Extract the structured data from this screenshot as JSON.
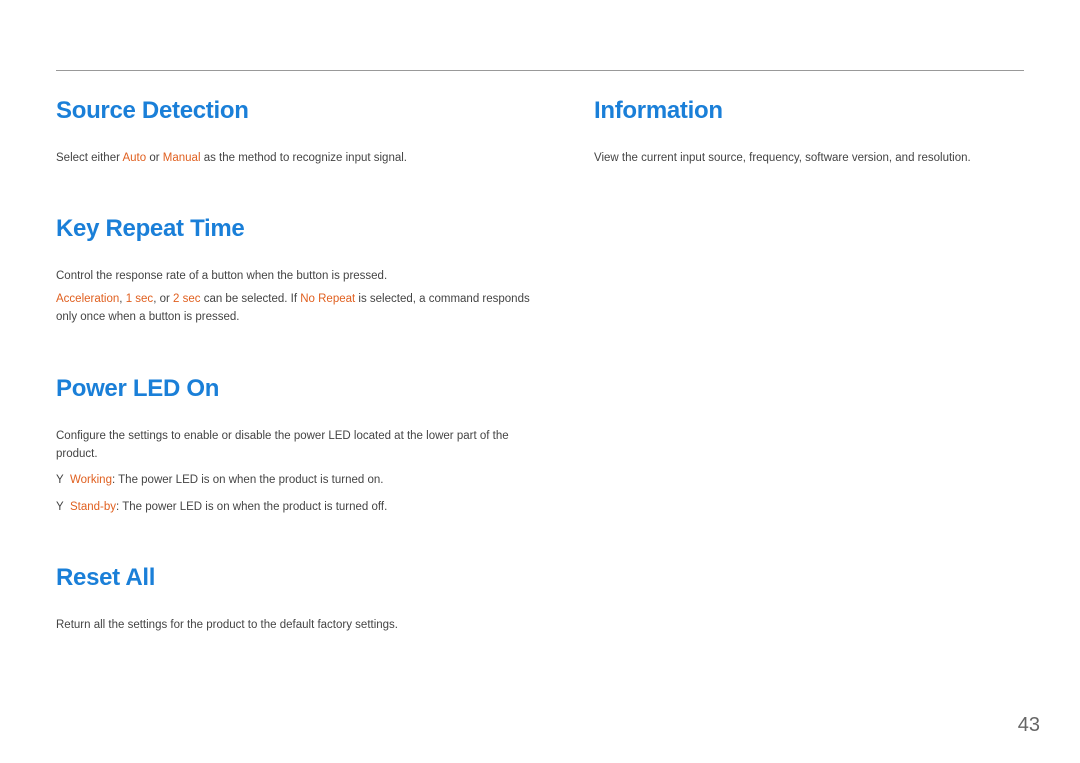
{
  "left": {
    "sourceDetection": {
      "title": "Source Detection",
      "bodyPrefix": "Select either ",
      "auto": "Auto",
      "or": " or ",
      "manual": "Manual",
      "bodySuffix": " as the method to recognize input signal."
    },
    "keyRepeatTime": {
      "title": "Key Repeat Time",
      "body1": "Control the response rate of a button when the button is pressed.",
      "acceleration": "Acceleration",
      "sep1": ", ",
      "oneSec": "1 sec",
      "sep2": ", or ",
      "twoSec": "2 sec",
      "mid": " can be selected. If ",
      "noRepeat": "No Repeat",
      "tail": " is selected, a command responds only once when a button is pressed."
    },
    "powerLed": {
      "title": "Power LED On",
      "body1": "Configure the settings to enable or disable the power LED located at the lower part of the product.",
      "working": "Working",
      "workingDesc": ": The power LED is on when the product is turned on.",
      "standby": "Stand-by",
      "standbyDesc": ": The power LED is on when the product is turned off."
    },
    "resetAll": {
      "title": "Reset All",
      "body": "Return all the settings for the product to the default factory settings."
    }
  },
  "right": {
    "information": {
      "title": "Information",
      "body": "View the current input source, frequency, software version, and resolution."
    }
  },
  "pageNumber": "43"
}
